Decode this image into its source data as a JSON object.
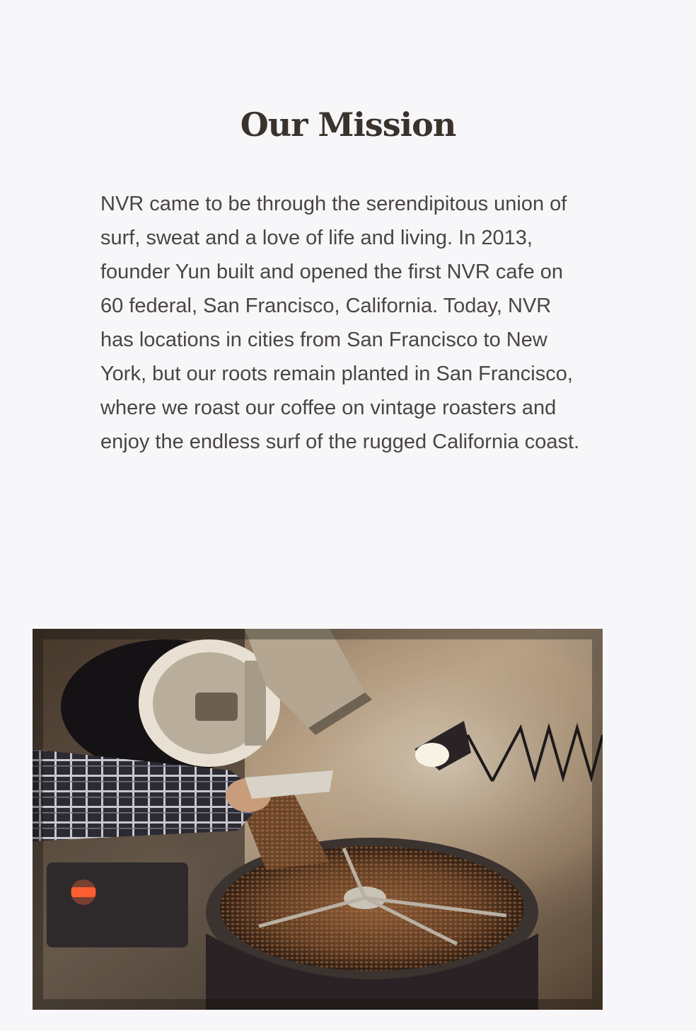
{
  "mission": {
    "title": "Our Mission",
    "body": "NVR came to be through the serendipitous union of surf, sweat and a love of life and living. In 2013, founder Yun built and opened the first NVR cafe on 60 federal, San Francisco, California. Today, NVR has locations in cities from San Francisco to New York, but our roots remain planted in San Francisco, where we roast our coffee on vintage roasters and enjoy the endless surf of the rugged California coast."
  },
  "photo": {
    "subject": "coffee-roaster-photo"
  },
  "colors": {
    "background": "#f7f7f9",
    "title": "#3a332d",
    "body_text": "#4a4542"
  }
}
